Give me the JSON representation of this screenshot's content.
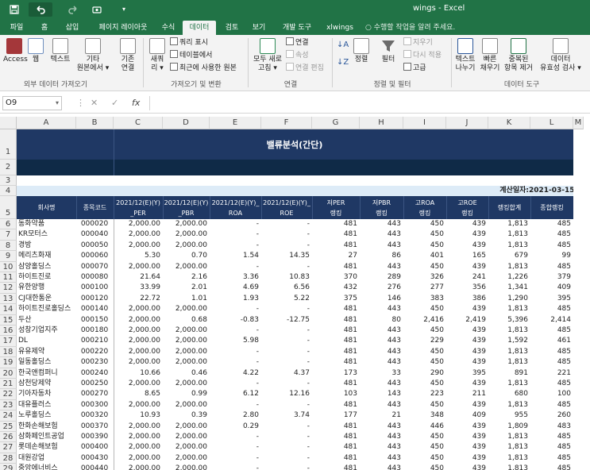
{
  "window": {
    "title": "wings - Excel"
  },
  "quick_access": {
    "save_icon": "save-icon",
    "undo_icon": "undo-icon",
    "redo_icon": "redo-icon",
    "qa_icon": "touch-mode-icon"
  },
  "tabs": [
    "파일",
    "홈",
    "삽입",
    "페이지 레이아웃",
    "수식",
    "데이터",
    "검토",
    "보기",
    "개발 도구",
    "xlwings"
  ],
  "active_tab": "데이터",
  "tell_me": "수행할 작업을 알려 주세요.",
  "ribbon": {
    "access": "Access",
    "web": "웹",
    "text": "텍스트",
    "other_sources": [
      "기타",
      "원본에서 ▾"
    ],
    "existing": [
      "기존",
      "연결"
    ],
    "new_query": [
      "새쿼",
      "리 ▾"
    ],
    "query_show": "쿼리 표시",
    "from_table": "테이블에서",
    "recent_sources": "최근에 사용한 원본",
    "refresh_all": [
      "모두 새로",
      "고침 ▾"
    ],
    "connections": "연결",
    "properties": "속성",
    "edit_links": "연결 편집",
    "sort": "정렬",
    "filter": "필터",
    "clear": "지우기",
    "reapply": "다시 적용",
    "advanced": "고급",
    "text_to_columns": [
      "텍스트",
      "나누기"
    ],
    "flash_fill": [
      "빠른",
      "채우기"
    ],
    "remove_duplicates": [
      "중복된",
      "항목 제거"
    ],
    "data_validation": [
      "데이터",
      "유효성 검사 ▾"
    ],
    "group_external": "외부 데이터 가져오기",
    "group_get_transform": "가져오기 및 변환",
    "group_connections": "연결",
    "group_sort_filter": "정렬 및 필터",
    "group_data_tools": "데이터 도구"
  },
  "formula_bar": {
    "name_box": "O9",
    "cancel": "✕",
    "enter": "✓",
    "fx": "fx",
    "value": ""
  },
  "columns": [
    "A",
    "B",
    "C",
    "D",
    "E",
    "F",
    "G",
    "H",
    "I",
    "J",
    "K",
    "L",
    "M"
  ],
  "rows": [
    "1",
    "2",
    "3",
    "4",
    "5",
    "6",
    "7",
    "8",
    "9",
    "10",
    "11",
    "12",
    "13",
    "14",
    "15",
    "16",
    "17",
    "18",
    "19",
    "20",
    "21",
    "22",
    "23",
    "24",
    "25",
    "26",
    "27",
    "28",
    "29"
  ],
  "sheet": {
    "title": "밸류분석(간단)",
    "calc_date_label": "계산일자:",
    "calc_date": "2021-03-15",
    "headers": [
      {
        "l1": "",
        "l2": "회사명"
      },
      {
        "l1": "",
        "l2": "종목코드"
      },
      {
        "l1": "2021/12(E)(Y)",
        "l2": "_PER"
      },
      {
        "l1": "2021/12(E)(Y)",
        "l2": "_PBR"
      },
      {
        "l1": "2021/12(E)(Y)_",
        "l2": "ROA"
      },
      {
        "l1": "2021/12(E)(Y)_",
        "l2": "ROE"
      },
      {
        "l1": "저PER",
        "l2": "랭킹"
      },
      {
        "l1": "저PBR",
        "l2": "랭킹"
      },
      {
        "l1": "고ROA",
        "l2": "랭킹"
      },
      {
        "l1": "고ROE",
        "l2": "랭킹"
      },
      {
        "l1": "",
        "l2": "랭킹합계"
      },
      {
        "l1": "",
        "l2": "종합랭킹"
      }
    ],
    "rows": [
      [
        "동화약품",
        "000020",
        "2,000.00",
        "2,000.00",
        "-",
        "-",
        "481",
        "443",
        "450",
        "439",
        "1,813",
        "485"
      ],
      [
        "KR모터스",
        "000040",
        "2,000.00",
        "2,000.00",
        "-",
        "-",
        "481",
        "443",
        "450",
        "439",
        "1,813",
        "485"
      ],
      [
        "경방",
        "000050",
        "2,000.00",
        "2,000.00",
        "-",
        "-",
        "481",
        "443",
        "450",
        "439",
        "1,813",
        "485"
      ],
      [
        "메리츠화재",
        "000060",
        "5.30",
        "0.70",
        "1.54",
        "14.35",
        "27",
        "86",
        "401",
        "165",
        "679",
        "99"
      ],
      [
        "삼양홀딩스",
        "000070",
        "2,000.00",
        "2,000.00",
        "-",
        "-",
        "481",
        "443",
        "450",
        "439",
        "1,813",
        "485"
      ],
      [
        "하이트진로",
        "000080",
        "21.64",
        "2.16",
        "3.36",
        "10.83",
        "370",
        "289",
        "326",
        "241",
        "1,226",
        "379"
      ],
      [
        "유한양행",
        "000100",
        "33.99",
        "2.01",
        "4.69",
        "6.56",
        "432",
        "276",
        "277",
        "356",
        "1,341",
        "409"
      ],
      [
        "CJ대한통운",
        "000120",
        "22.72",
        "1.01",
        "1.93",
        "5.22",
        "375",
        "146",
        "383",
        "386",
        "1,290",
        "395"
      ],
      [
        "하이트진로홀딩스",
        "000140",
        "2,000.00",
        "2,000.00",
        "-",
        "-",
        "481",
        "443",
        "450",
        "439",
        "1,813",
        "485"
      ],
      [
        "두산",
        "000150",
        "2,000.00",
        "0.68",
        "-0.83",
        "-12.75",
        "481",
        "80",
        "2,416",
        "2,419",
        "5,396",
        "2,414"
      ],
      [
        "성창기업지주",
        "000180",
        "2,000.00",
        "2,000.00",
        "-",
        "-",
        "481",
        "443",
        "450",
        "439",
        "1,813",
        "485"
      ],
      [
        "DL",
        "000210",
        "2,000.00",
        "2,000.00",
        "5.98",
        "-",
        "481",
        "443",
        "229",
        "439",
        "1,592",
        "461"
      ],
      [
        "유유제약",
        "000220",
        "2,000.00",
        "2,000.00",
        "-",
        "-",
        "481",
        "443",
        "450",
        "439",
        "1,813",
        "485"
      ],
      [
        "일동홀딩스",
        "000230",
        "2,000.00",
        "2,000.00",
        "-",
        "-",
        "481",
        "443",
        "450",
        "439",
        "1,813",
        "485"
      ],
      [
        "한국앤컴퍼니",
        "000240",
        "10.66",
        "0.46",
        "4.22",
        "4.37",
        "173",
        "33",
        "290",
        "395",
        "891",
        "221"
      ],
      [
        "삼천당제약",
        "000250",
        "2,000.00",
        "2,000.00",
        "-",
        "-",
        "481",
        "443",
        "450",
        "439",
        "1,813",
        "485"
      ],
      [
        "기아자동차",
        "000270",
        "8.65",
        "0.99",
        "6.12",
        "12.16",
        "103",
        "143",
        "223",
        "211",
        "680",
        "100"
      ],
      [
        "대유플러스",
        "000300",
        "2,000.00",
        "2,000.00",
        "-",
        "-",
        "481",
        "443",
        "450",
        "439",
        "1,813",
        "485"
      ],
      [
        "노루홀딩스",
        "000320",
        "10.93",
        "0.39",
        "2.80",
        "3.74",
        "177",
        "21",
        "348",
        "409",
        "955",
        "260"
      ],
      [
        "한화손해보험",
        "000370",
        "2,000.00",
        "2,000.00",
        "0.29",
        "-",
        "481",
        "443",
        "446",
        "439",
        "1,809",
        "483"
      ],
      [
        "삼화페인트공업",
        "000390",
        "2,000.00",
        "2,000.00",
        "-",
        "-",
        "481",
        "443",
        "450",
        "439",
        "1,813",
        "485"
      ],
      [
        "롯데손해보험",
        "000400",
        "2,000.00",
        "2,000.00",
        "-",
        "-",
        "481",
        "443",
        "450",
        "439",
        "1,813",
        "485"
      ],
      [
        "대원강업",
        "000430",
        "2,000.00",
        "2,000.00",
        "-",
        "-",
        "481",
        "443",
        "450",
        "439",
        "1,813",
        "485"
      ],
      [
        "중앙에너비스",
        "000440",
        "2,000.00",
        "2,000.00",
        "-",
        "-",
        "481",
        "443",
        "450",
        "439",
        "1,813",
        "485"
      ]
    ]
  },
  "colors": {
    "excel_green": "#217346",
    "header_navy": "#1f3864",
    "band_dark": "#0f2a47",
    "date_band": "#ddebf7"
  }
}
